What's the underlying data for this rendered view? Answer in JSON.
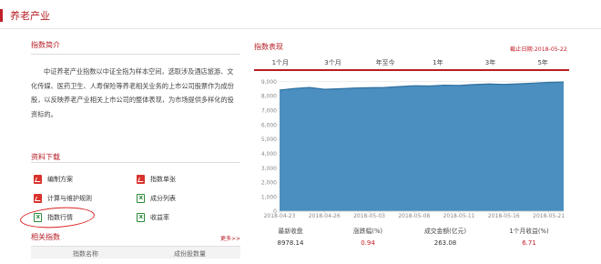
{
  "page": {
    "title": "养老产业"
  },
  "intro": {
    "title": "指数简介",
    "text": "中证养老产业指数以中证全指为样本空间，选取涉及酒店旅游、文化传媒、医药卫生、人寿保险等养老相关业务的上市公司股票作为成份股，以反映养老产业相关上市公司的整体表现，为市场提供多样化的投资标的。"
  },
  "downloads": {
    "title": "资料下载",
    "items": [
      {
        "label": "编制方案",
        "icon": "pdf-icon"
      },
      {
        "label": "指数单张",
        "icon": "pdf-icon"
      },
      {
        "label": "计算与维护规则",
        "icon": "pdf-icon"
      },
      {
        "label": "成分列表",
        "icon": "excel-icon"
      },
      {
        "label": "指数行情",
        "icon": "excel-icon"
      },
      {
        "label": "收益率",
        "icon": "excel-icon"
      }
    ]
  },
  "related": {
    "title": "相关指数",
    "more": "更多>>",
    "columns": [
      "指数名称",
      "成份股数量"
    ]
  },
  "performance": {
    "title": "指数表现",
    "as_of": "截止日期:2018-05-22",
    "tabs": [
      "1个月",
      "3个月",
      "年至今",
      "1年",
      "3年",
      "5年"
    ],
    "active_tab": 0
  },
  "chart_data": {
    "type": "area",
    "x_ticks": [
      "2018-04-23",
      "2018-04-26",
      "2018-05-03",
      "2018-05-08",
      "2018-05-11",
      "2018-05-16",
      "2018-05-21"
    ],
    "y_ticks": [
      0,
      1000,
      2000,
      3000,
      4000,
      5000,
      6000,
      7000,
      8000,
      9000
    ],
    "y_tick_labels": [
      "0",
      "1,000",
      "2,000",
      "3,000",
      "4,000",
      "5,000",
      "6,000",
      "7,000",
      "8,000",
      "9,000"
    ],
    "ylim": [
      0,
      9300
    ],
    "x": [
      "2018-04-23",
      "2018-04-24",
      "2018-04-25",
      "2018-04-26",
      "2018-04-27",
      "2018-05-02",
      "2018-05-03",
      "2018-05-04",
      "2018-05-07",
      "2018-05-08",
      "2018-05-09",
      "2018-05-10",
      "2018-05-11",
      "2018-05-14",
      "2018-05-15",
      "2018-05-16",
      "2018-05-17",
      "2018-05-18",
      "2018-05-21",
      "2018-05-22"
    ],
    "values": [
      8420,
      8530,
      8600,
      8470,
      8510,
      8560,
      8580,
      8600,
      8660,
      8720,
      8700,
      8760,
      8740,
      8800,
      8840,
      8810,
      8850,
      8900,
      8950,
      8978
    ],
    "grid": true,
    "color": "#4a8fc0",
    "line_color": "#2f6f9f"
  },
  "stats": [
    {
      "label": "最新收盘",
      "value": "8978.14",
      "highlight": false
    },
    {
      "label": "涨跌幅(%)",
      "value": "0.94",
      "highlight": true
    },
    {
      "label": "成交金额(亿元)",
      "value": "263.08",
      "highlight": false
    },
    {
      "label": "1个月收益(%)",
      "value": "6.71",
      "highlight": true
    }
  ]
}
